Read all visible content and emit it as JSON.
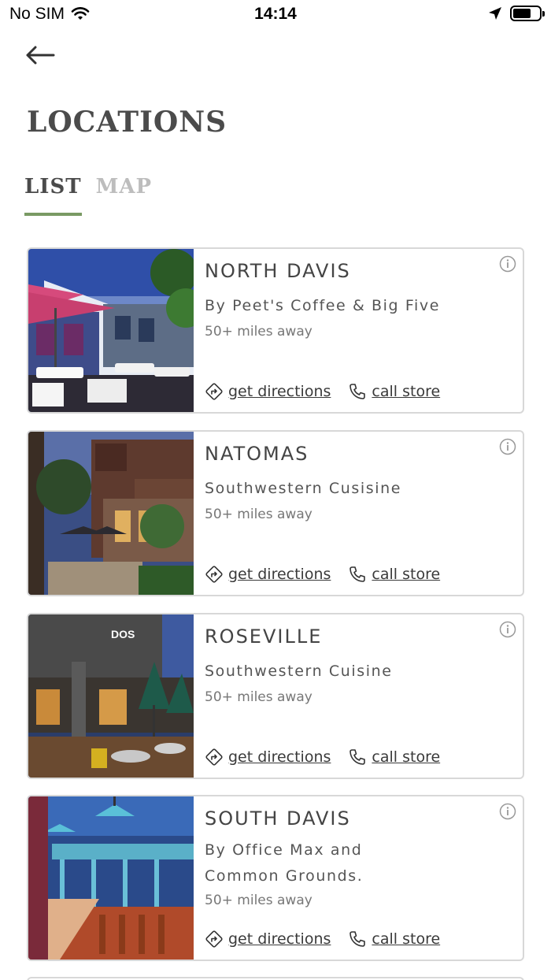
{
  "status_bar": {
    "carrier": "No SIM",
    "time": "14:14"
  },
  "header": {
    "title": "LOCATIONS"
  },
  "tabs": [
    {
      "label": "LIST",
      "active": true
    },
    {
      "label": "MAP",
      "active": false
    }
  ],
  "locations": [
    {
      "name": "NORTH DAVIS",
      "subtitle": "By Peet's Coffee & Big Five",
      "distance": "50+ miles away",
      "directions_label": "get directions",
      "call_label": "call store"
    },
    {
      "name": "NATOMAS",
      "subtitle": "Southwestern Cusisine",
      "distance": "50+ miles away",
      "directions_label": "get directions",
      "call_label": "call store"
    },
    {
      "name": "ROSEVILLE",
      "subtitle": "Southwestern Cuisine",
      "distance": "50+ miles away",
      "directions_label": "get directions",
      "call_label": "call store"
    },
    {
      "name": "SOUTH DAVIS",
      "subtitle": "By Office Max and Common Grounds.",
      "distance": "50+ miles away",
      "directions_label": "get directions",
      "call_label": "call store"
    }
  ],
  "colors": {
    "accent": "#7a9a64",
    "title": "#4b4b4b",
    "inactive_tab": "#bdbdbd",
    "card_border": "#d8d8d8"
  },
  "icons": {
    "back": "arrow-left-icon",
    "info": "info-icon",
    "directions": "directions-icon",
    "call": "phone-icon",
    "wifi": "wifi-icon",
    "location": "location-arrow-icon",
    "battery": "battery-icon"
  }
}
